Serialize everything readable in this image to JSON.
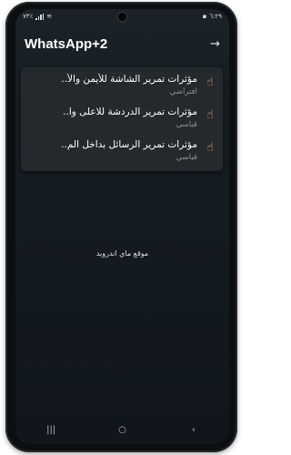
{
  "status_bar": {
    "time": "٦:٢٩",
    "battery": "٧٣٪"
  },
  "header": {
    "title": "WhatsApp+2",
    "back_icon": "arrow-right-icon"
  },
  "menu": {
    "items": [
      {
        "title": "مؤثرات تمرير الشاشة للأيمن والأ..",
        "subtitle": "افتراضي",
        "icon": "hand-swipe-icon"
      },
      {
        "title": "مؤثرات تمرير الدردشة للاعلى وا..",
        "subtitle": "قياسي",
        "icon": "hand-swipe-icon"
      },
      {
        "title": "مؤثرات تمرير الرسائل بداخل الم..",
        "subtitle": "قياسي",
        "icon": "hand-swipe-icon"
      }
    ]
  },
  "watermark": "موقع ماي اندرويد",
  "nav_bar": {
    "recents": "|||",
    "home": "○",
    "back": "‹"
  },
  "colors": {
    "background": "#141b21",
    "panel": "#24292d",
    "text": "#ffffff",
    "subtext": "#8a9096",
    "icon_accent": "#e8b27a"
  }
}
